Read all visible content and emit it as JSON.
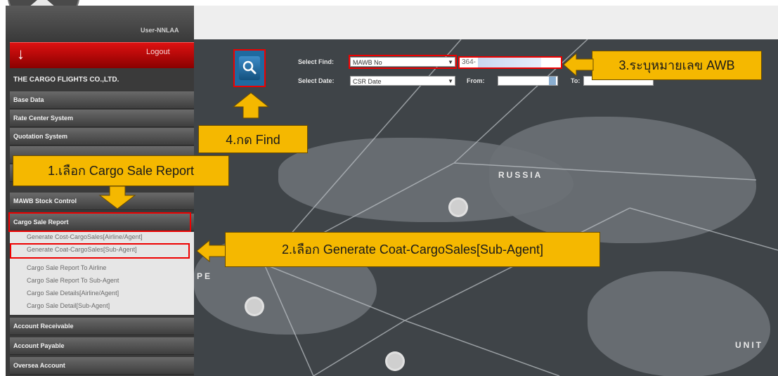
{
  "sidebar": {
    "user_name": "User-NNLAA",
    "logout_label": "Logout",
    "company": "THE CARGO FLIGHTS CO.,LTD.",
    "menu": [
      {
        "label": "Base Data"
      },
      {
        "label": "Rate Center System"
      },
      {
        "label": "Quotation System"
      },
      {
        "label": "MAWB Stock Control"
      },
      {
        "label": "Cargo Sale Report"
      },
      {
        "label": "Account Receivable"
      },
      {
        "label": "Account Payable"
      },
      {
        "label": "Oversea Account"
      }
    ],
    "submenu": [
      {
        "label": "Generate Cost-CargoSales[Airline/Agent]"
      },
      {
        "label": "Generate Coat-CargoSales[Sub-Agent]"
      },
      {
        "label": "Cargo Sale Report To Airline"
      },
      {
        "label": "Cargo Sale Report To Sub-Agent"
      },
      {
        "label": "Cargo Sale Details[Airline/Agent]"
      },
      {
        "label": "Cargo Sale Detail[Sub-Agent]"
      }
    ]
  },
  "toolbar": {
    "select_find_label": "Select Find:",
    "select_find_value": "MAWB No",
    "awb_value": "364-",
    "select_date_label": "Select Date:",
    "select_date_value": "CSR Date",
    "from_label": "From:",
    "to_label": "To:"
  },
  "map": {
    "label_russia": "RUSSIA",
    "label_europe": "PE",
    "label_united": "UNIT"
  },
  "callouts": {
    "step1": "1.เลือก Cargo Sale Report",
    "step2": "2.เลือก Generate Coat-CargoSales[Sub-Agent]",
    "step3": "3.ระบุหมายเลข AWB",
    "step4": "4.กด Find"
  },
  "colors": {
    "callout_bg": "#f5b800",
    "highlight": "#ee0000",
    "logout_red": "#cc1111"
  }
}
